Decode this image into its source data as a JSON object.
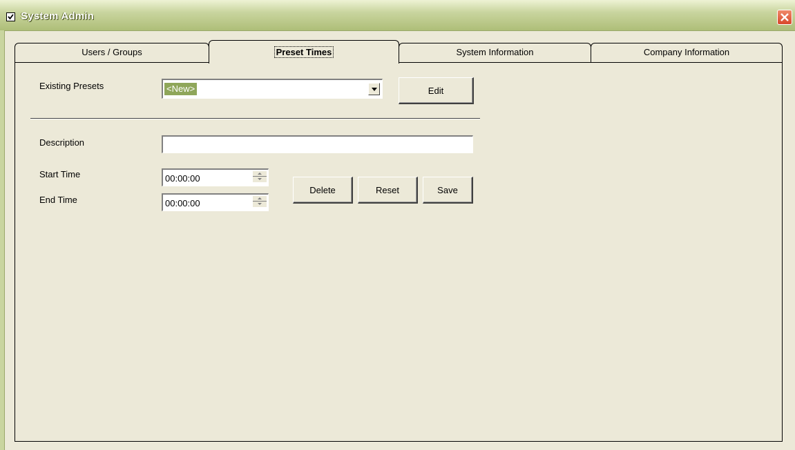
{
  "window": {
    "title": "System Admin"
  },
  "tabs": [
    {
      "label": "Users / Groups"
    },
    {
      "label": "Preset Times"
    },
    {
      "label": "System Information"
    },
    {
      "label": "Company Information"
    }
  ],
  "active_tab": "Preset Times",
  "presets": {
    "label": "Existing Presets",
    "selected": "<New>",
    "edit_label": "Edit"
  },
  "form": {
    "description_label": "Description",
    "description_value": "",
    "start_label": "Start Time",
    "start_value": "00:00:00",
    "end_label": "End Time",
    "end_value": "00:00:00"
  },
  "actions": {
    "delete_label": "Delete",
    "reset_label": "Reset",
    "save_label": "Save"
  },
  "colors": {
    "selection_highlight": "#8fa65a",
    "close_button": "#d8472a",
    "window_bg": "#ece9d8"
  }
}
